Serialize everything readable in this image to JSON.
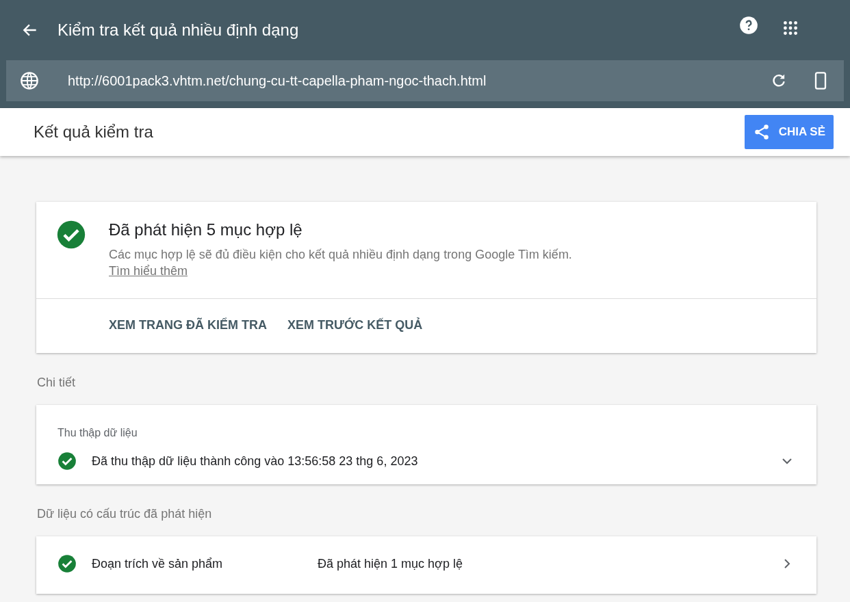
{
  "app_bar": {
    "title": "Kiểm tra kết quả nhiều định dạng"
  },
  "url_bar": {
    "url": "http://6001pack3.vhtm.net/chung-cu-tt-capella-pham-ngoc-thach.html"
  },
  "results_bar": {
    "title": "Kết quả kiểm tra",
    "share_button": "CHIA SẺ"
  },
  "summary": {
    "valid": true,
    "title": "Đã phát hiện 5 mục hợp lệ",
    "description": "Các mục hợp lệ sẽ đủ điều kiện cho kết quả nhiều định dạng trong Google Tìm kiếm.",
    "link": "Tìm hiểu thêm",
    "actions": [
      "XEM TRANG ĐÃ KIỂM TRA",
      "XEM TRƯỚC KẾT QUẢ"
    ]
  },
  "details": {
    "heading": "Chi tiết",
    "card_title": "Thu thập dữ liệu",
    "valid": true,
    "status": "Đã thu thập dữ liệu thành công vào 13:56:58 23 thg 6, 2023",
    "expanded": false
  },
  "structured": {
    "heading": "Dữ liệu có cấu trúc đã phát hiện",
    "items": [
      {
        "valid": true,
        "name": "Đoạn trích về sản phẩm",
        "result": "Đã phát hiện 1 mục hợp lệ"
      }
    ]
  }
}
